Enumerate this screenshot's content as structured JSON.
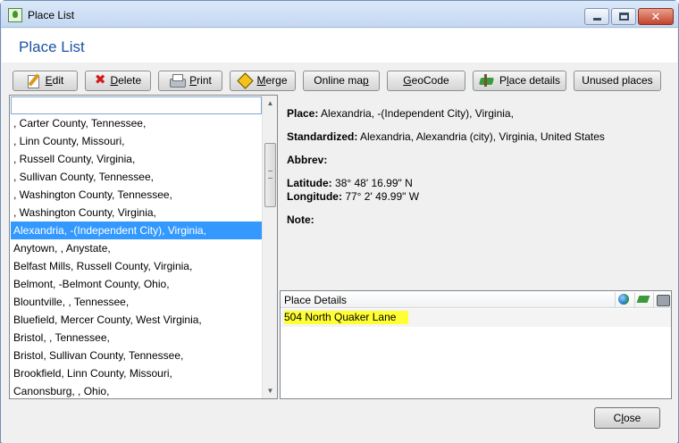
{
  "window": {
    "title": "Place List",
    "close_glyph": "✕"
  },
  "header": {
    "title": "Place List"
  },
  "toolbar": {
    "edit": {
      "accel": "E",
      "rest": "dit",
      "icon": "pencil-icon"
    },
    "delete": {
      "accel": "D",
      "rest": "elete",
      "icon": "x-icon",
      "glyph": "✖"
    },
    "print": {
      "accel": "P",
      "rest": "rint",
      "icon": "printer-icon"
    },
    "merge": {
      "accel": "M",
      "rest": "erge",
      "icon": "merge-sign-icon"
    },
    "online_map": {
      "pre": "Online ma",
      "accel": "p",
      "rest": ""
    },
    "geocode": {
      "pre": "",
      "accel": "G",
      "rest": "eoCode"
    },
    "place_details": {
      "pre": "P",
      "accel": "l",
      "rest": "ace details",
      "icon": "map-icon"
    },
    "unused_places": {
      "label": "Unused places"
    }
  },
  "place_list": {
    "search_value": "",
    "items": [
      ", Carter County, Tennessee,",
      ", Linn County, Missouri,",
      ", Russell County, Virginia,",
      ", Sullivan County, Tennessee,",
      ", Washington County, Tennessee,",
      ", Washington County, Virginia,",
      "Alexandria, -(Independent City), Virginia,",
      "Anytown, , Anystate,",
      "Belfast Mills, Russell County, Virginia,",
      "Belmont, -Belmont County, Ohio,",
      "Blountville, , Tennessee,",
      "Bluefield, Mercer County, West Virginia,",
      "Bristol, , Tennessee,",
      "Bristol, Sullivan County, Tennessee,",
      "Brookfield, Linn County, Missouri,",
      "Canonsburg, , Ohio,"
    ],
    "selected_index": 6,
    "scroll_up": "▲",
    "scroll_down": "▼"
  },
  "details": {
    "place_label": "Place:",
    "place_value": "Alexandria, -(Independent City), Virginia,",
    "standardized_label": "Standardized:",
    "standardized_value": "Alexandria, Alexandria (city), Virginia, United States",
    "abbrev_label": "Abbrev:",
    "abbrev_value": "",
    "latitude_label": "Latitude:",
    "latitude_value": "38° 48' 16.99\" N",
    "longitude_label": "Longitude:",
    "longitude_value": "77° 2' 49.99\" W",
    "note_label": "Note:",
    "note_value": ""
  },
  "place_details_panel": {
    "header": "Place Details",
    "icons": [
      "globe-icon",
      "map-icon",
      "camera-icon"
    ],
    "rows": [
      "504 North Quaker Lane"
    ],
    "highlight_color": "#ffff33"
  },
  "footer": {
    "close": {
      "pre": "C",
      "accel": "l",
      "rest": "ose"
    }
  }
}
